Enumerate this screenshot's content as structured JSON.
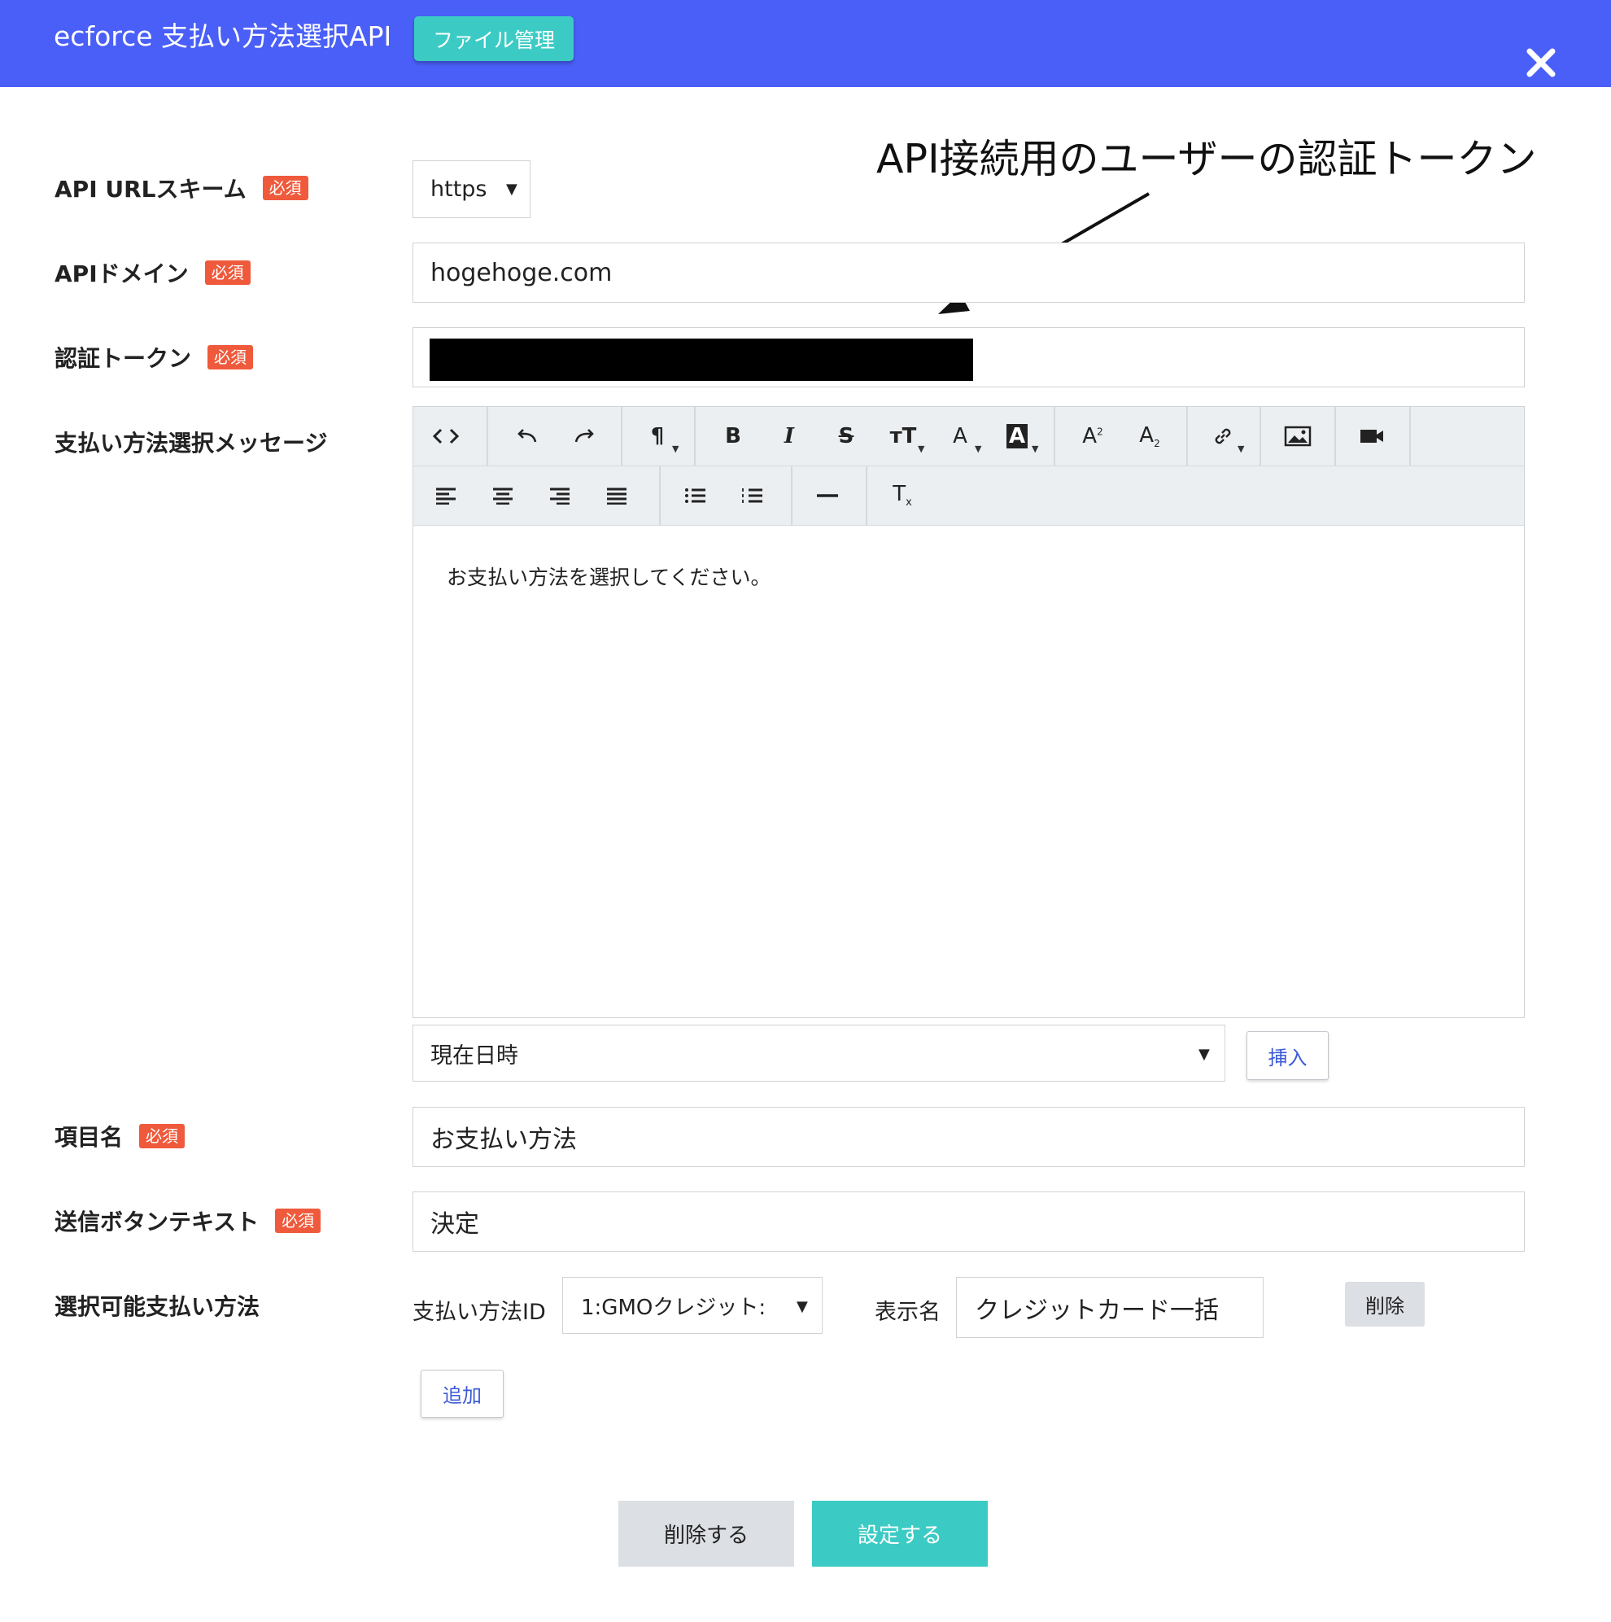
{
  "header": {
    "title": "ecforce 支払い方法選択API",
    "file_button": "ファイル管理",
    "close_icon": "close-icon"
  },
  "annotation": {
    "text": "API接続用のユーザーの認証トークン"
  },
  "required_badge": "必須",
  "form": {
    "scheme": {
      "label": "API URLスキーム",
      "value": "https"
    },
    "domain": {
      "label": "APIドメイン",
      "value": "hogehoge.com"
    },
    "token": {
      "label": "認証トークン"
    },
    "message": {
      "label": "支払い方法選択メッセージ",
      "body": "お支払い方法を選択してください。"
    },
    "insert_var": {
      "value": "現在日時",
      "button": "挿入"
    },
    "item_name": {
      "label": "項目名",
      "value": "お支払い方法"
    },
    "submit_text": {
      "label": "送信ボタンテキスト",
      "value": "決定"
    },
    "payment_methods": {
      "label": "選択可能支払い方法",
      "id_label": "支払い方法ID",
      "id_value": "1:GMOクレジット:",
      "name_label": "表示名",
      "name_value": "クレジットカード一括",
      "remove_button": "削除",
      "add_button": "追加"
    }
  },
  "actions": {
    "delete": "削除する",
    "submit": "設定する"
  },
  "colors": {
    "header_bg": "#4a5ff7",
    "accent_teal": "#3ccbc4",
    "required_red": "#ef5a3c",
    "link_blue": "#3b59d6"
  }
}
